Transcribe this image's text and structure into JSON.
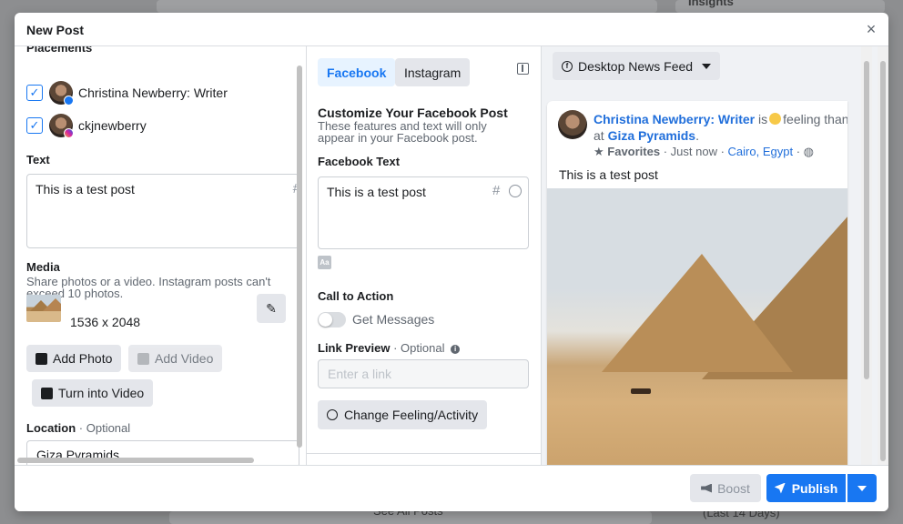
{
  "modal": {
    "title": "New Post",
    "close": "×"
  },
  "background": {
    "insights": "Insights",
    "see_all_posts": "See All Posts",
    "last_days": "(Last 14 Days)"
  },
  "left": {
    "placements_label": "Placements",
    "accounts": [
      {
        "name": "Christina Newberry: Writer",
        "checked": true,
        "network": "facebook"
      },
      {
        "name": "ckjnewberry",
        "checked": true,
        "network": "instagram"
      }
    ],
    "text_label": "Text",
    "text_value": "This is a test post",
    "media_label": "Media",
    "media_hint": "Share photos or a video. Instagram posts can't exceed 10 photos.",
    "media_size": "1536 x 2048",
    "add_photo": "Add Photo",
    "add_video": "Add Video",
    "turn_into_video": "Turn into Video",
    "location_label": "Location",
    "location_optional": "· Optional",
    "location_value": "Giza Pyramids"
  },
  "middle": {
    "tabs": [
      {
        "label": "Facebook",
        "active": true
      },
      {
        "label": "Instagram",
        "active": false
      }
    ],
    "customize_title": "Customize Your Facebook Post",
    "customize_sub": "These features and text will only appear in your Facebook post.",
    "fb_text_label": "Facebook Text",
    "fb_text_value": "This is a test post",
    "cta_label": "Call to Action",
    "cta_option": "Get Messages",
    "cta_enabled": false,
    "link_label": "Link Preview",
    "link_optional": "· Optional",
    "link_placeholder": "Enter a link",
    "feeling_button": "Change Feeling/Activity"
  },
  "preview": {
    "placement_select": "Desktop News Feed",
    "page_name": "Christina Newberry: Writer",
    "feeling_text": "is",
    "feeling_rest": "feeling than",
    "at_text": "at",
    "place": "Giza Pyramids",
    "dot": ".",
    "favorites": "Favorites",
    "time": "· Just now ·",
    "location": "Cairo, Egypt",
    "post_text": "This is a test post"
  },
  "footer": {
    "boost": "Boost",
    "publish": "Publish"
  },
  "colors": {
    "primary": "#1877f2",
    "link": "#216fdb",
    "muted": "#606770"
  }
}
